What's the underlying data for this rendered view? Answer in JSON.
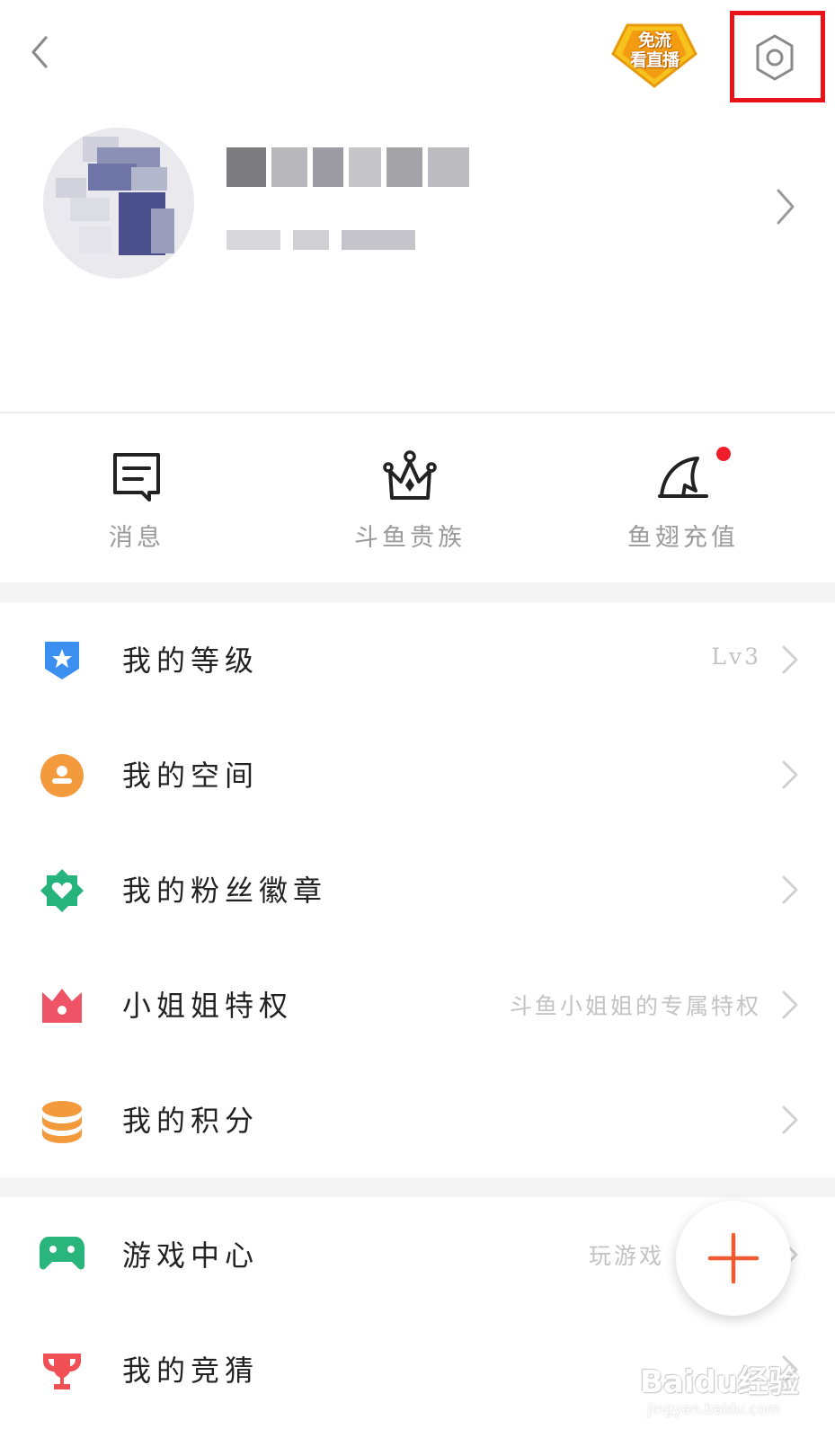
{
  "header": {
    "back_icon": "chevron-left-icon",
    "promo_badge": "免流\n看直播",
    "settings_icon": "gear-icon"
  },
  "profile": {
    "username": "",
    "subtitle": "",
    "arrow_icon": "chevron-right-icon"
  },
  "quick_actions": [
    {
      "label": "消息",
      "icon": "message-icon"
    },
    {
      "label": "斗鱼贵族",
      "icon": "crown-icon"
    },
    {
      "label": "鱼翅充值",
      "icon": "fin-icon",
      "badge_dot": true
    }
  ],
  "menu_group_1": [
    {
      "title": "我的等级",
      "hint": "Lv3",
      "icon": "level-badge-icon",
      "icon_color": "#3a8ff0"
    },
    {
      "title": "我的空间",
      "hint": "",
      "icon": "person-circle-icon",
      "icon_color": "#f39a3d"
    },
    {
      "title": "我的粉丝徽章",
      "hint": "",
      "icon": "fan-badge-icon",
      "icon_color": "#26b37c"
    },
    {
      "title": "小姐姐特权",
      "hint": "斗鱼小姐姐的专属特权",
      "icon": "crown-pink-icon",
      "icon_color": "#ef5366"
    },
    {
      "title": "我的积分",
      "hint": "",
      "icon": "coins-icon",
      "icon_color": "#f39a3d"
    }
  ],
  "menu_group_2": [
    {
      "title": "游戏中心",
      "hint": "玩游戏",
      "icon": "gamepad-icon",
      "icon_color": "#29b57c"
    },
    {
      "title": "我的竞猜",
      "hint": "",
      "icon": "trophy-icon",
      "icon_color": "#ef4f55"
    }
  ],
  "fab": {
    "icon": "plus-icon",
    "color": "#ef5b33"
  },
  "watermark": {
    "logo": "Baidu经验",
    "url": "jingyan.baidu.com"
  },
  "colors": {
    "highlight": "#e8141a",
    "accent": "#ef5b33",
    "hint_text": "#c3c3c3"
  }
}
